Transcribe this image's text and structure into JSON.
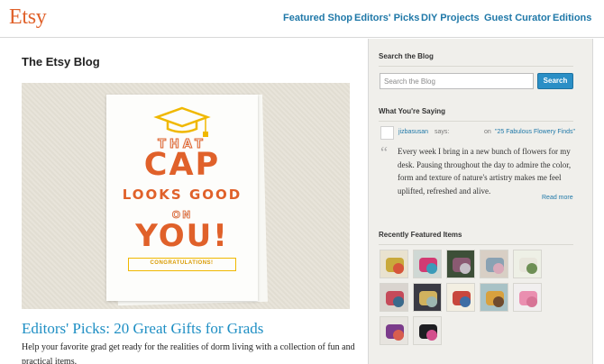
{
  "header": {
    "logo": "Etsy",
    "nav": [
      "Featured Shop",
      "Editors' Picks",
      "DIY Projects",
      "Guest Curator",
      "Editions"
    ]
  },
  "main": {
    "blog_title": "The Etsy Blog",
    "hero_card": {
      "line1": "THAT",
      "line2": "CAP",
      "line3": "LOOKS GOOD",
      "line4": "ON",
      "line5": "YOU!",
      "banner": "CONGRATULATIONS!"
    },
    "post_title": "Editors' Picks: 20 Great Gifts for Grads",
    "post_excerpt": "Help your favorite grad get ready for the realities of dorm living with a collection of fun and practical items."
  },
  "sidebar": {
    "search_heading": "Search the Blog",
    "search_placeholder": "Search the Blog",
    "search_button": "Search",
    "comments_heading": "What You're Saying",
    "comment": {
      "user": "jizbasusan",
      "says": "says:",
      "on": "on",
      "post": "\"25 Fabulous Flowery Finds\"",
      "text": "Every week I bring in a new bunch of flowers for my desk. Pausing throughout the day to admire the color, form and texture of nature's artistry makes me feel uplifted, refreshed and alive.",
      "read_more": "Read more"
    },
    "featured_heading": "Recently Featured Items",
    "featured_items": [
      {
        "icon": "garland-thumbnail",
        "colors": [
          "#e9e2cf",
          "#c9a93b",
          "#d6553a"
        ]
      },
      {
        "icon": "crochet-squares-thumbnail",
        "colors": [
          "#cfd8d4",
          "#d23b73",
          "#3a9bb9"
        ]
      },
      {
        "icon": "garden-scene-thumbnail",
        "colors": [
          "#3d4f38",
          "#8a5a72",
          "#c6c0c7"
        ]
      },
      {
        "icon": "fabric-bundle-thumbnail",
        "colors": [
          "#d8cfc5",
          "#8aa2b3",
          "#d9a9b9"
        ]
      },
      {
        "icon": "vase-thumbnail",
        "colors": [
          "#eef0e6",
          "#e8e6dc",
          "#6e8f55"
        ]
      },
      {
        "icon": "bracelets-thumbnail",
        "colors": [
          "#d9d4cf",
          "#c54a5a",
          "#3b6a8c"
        ]
      },
      {
        "icon": "yarn-thumbnail",
        "colors": [
          "#3a3a44",
          "#d1b25e",
          "#9db7b2"
        ]
      },
      {
        "icon": "notepad-thumbnail",
        "colors": [
          "#f3efe2",
          "#c8473d",
          "#3e6ea5"
        ]
      },
      {
        "icon": "figurine-thumbnail",
        "colors": [
          "#a8c2c6",
          "#d8a13e",
          "#6f4b2e"
        ]
      },
      {
        "icon": "pink-cup-thumbnail",
        "colors": [
          "#f1efef",
          "#ea8fb0",
          "#d77496"
        ]
      },
      {
        "icon": "purple-shirt-thumbnail",
        "colors": [
          "#e7e4df",
          "#7b3b8b",
          "#d85e4f"
        ]
      },
      {
        "icon": "straws-thumbnail",
        "colors": [
          "#ecebe7",
          "#1e1e22",
          "#d34f8d"
        ]
      }
    ]
  }
}
